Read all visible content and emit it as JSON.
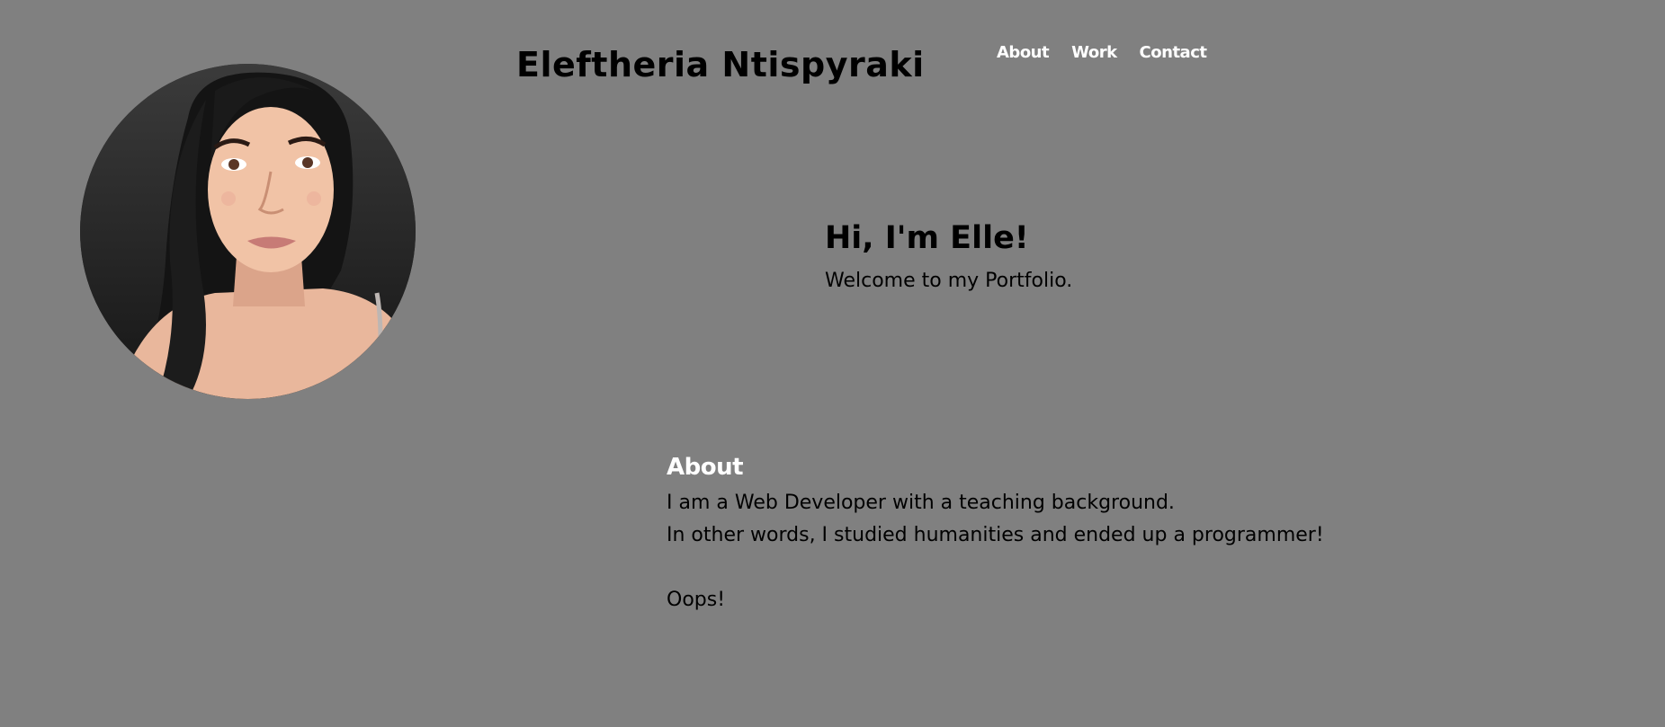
{
  "header": {
    "title": "Eleftheria Ntispyraki",
    "avatar_icon": "cartoon-portrait-avatar"
  },
  "nav": {
    "items": [
      {
        "label": "About"
      },
      {
        "label": "Work"
      },
      {
        "label": "Contact"
      }
    ]
  },
  "hero": {
    "heading": "Hi, I'm Elle!",
    "subtitle": "Welcome to my Portfolio."
  },
  "about": {
    "heading": "About",
    "lines": [
      "I am a Web Developer with a teaching background.",
      "In other words, I studied humanities and ended up a programmer!",
      "Oops!"
    ]
  },
  "colors": {
    "background": "#808080",
    "text": "#000000",
    "accent_text": "#ffffff"
  }
}
